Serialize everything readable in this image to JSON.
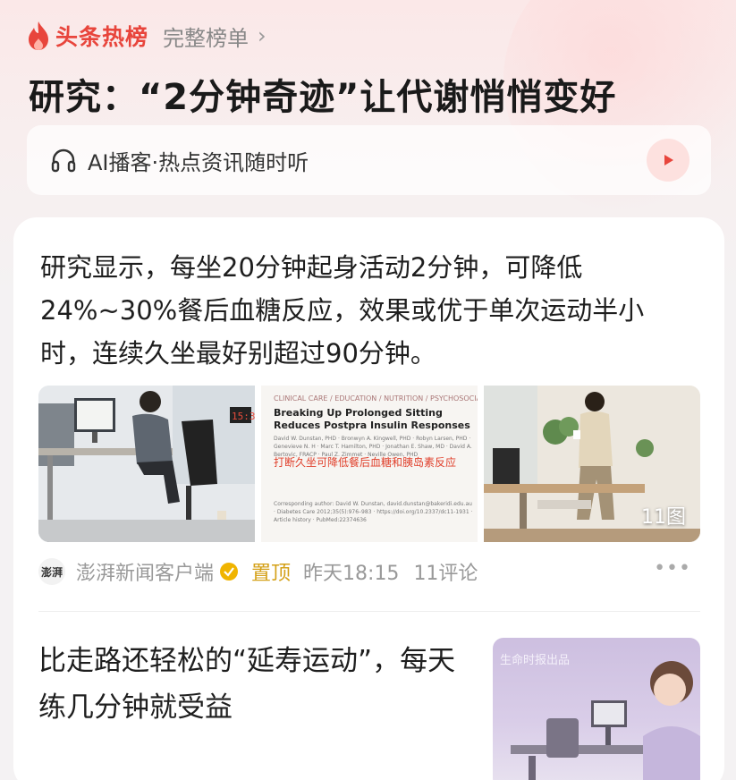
{
  "header": {
    "brand": "头条热榜",
    "full_list": "完整榜单",
    "chevron": "›"
  },
  "headline": "研究：“2分钟奇迹”让代谢悄悄变好",
  "podcast": {
    "label": "AI播客·热点资讯随时听"
  },
  "article": {
    "summary": "研究显示，每坐20分钟起身活动2分钟，可降低24%~30%餐后血糖反应，效果或优于单次运动半小时，连续久坐最好别超过90分钟。",
    "images": {
      "paper": {
        "category": "CLINICAL CARE / EDUCATION / NUTRITION / PSYCHOSOCIAL RESEA",
        "title": "Breaking Up Prolonged Sitting Reduces Postpra Insulin Responses",
        "authors": "David W. Dunstan, PHD · Bronwyn A. Kingwell, PHD · Robyn Larsen, PHD · Genevieve N. H · Marc T. Hamilton, PHD · Jonathan E. Shaw, MD · David A. Bertovic, FRACP · Paul Z. Zimmet · Neville Owen, PHD",
        "cn_title": "打断久坐可降低餐后血糖和胰岛素反应",
        "footer": "Corresponding author: David W. Dunstan, david.dunstan@bakeridi.edu.au · Diabetes Care 2012;35(5):976–983 · https://doi.org/10.2337/dc11-1931 · Article history · PubMed:22374636"
      },
      "clock": "15:3",
      "count": "11图"
    },
    "source_logo": "澎湃",
    "source": "澎湃新闻客户端",
    "pinned": "置顶",
    "time": "昨天18:15",
    "comments": "11评论",
    "more": "•••"
  },
  "item2": {
    "title": "比走路还轻松的“延寿运动”，每天练几分钟就受益",
    "brand_tag": "生命时报出品"
  },
  "colors": {
    "accent": "#e8453c",
    "pinned": "#d4a017",
    "verified": "#f0b400"
  }
}
